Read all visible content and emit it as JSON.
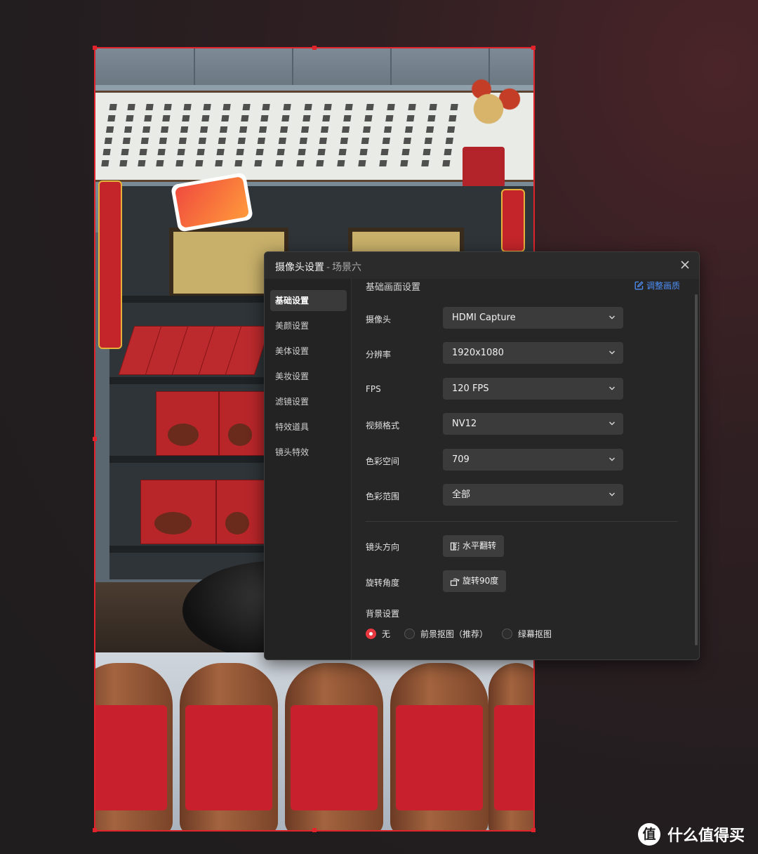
{
  "dialog": {
    "title": "摄像头设置",
    "title_separator": "-",
    "scene_name": "场景六",
    "close_icon": "close-icon"
  },
  "sidebar": {
    "items": [
      {
        "label": "基础设置",
        "active": true
      },
      {
        "label": "美颜设置",
        "active": false
      },
      {
        "label": "美体设置",
        "active": false
      },
      {
        "label": "美妆设置",
        "active": false
      },
      {
        "label": "滤镜设置",
        "active": false
      },
      {
        "label": "特效道具",
        "active": false
      },
      {
        "label": "镜头特效",
        "active": false
      }
    ]
  },
  "main": {
    "section_title": "基础画面设置",
    "adjust_link": "调整画质",
    "fields": [
      {
        "label": "摄像头",
        "value": "HDMI Capture"
      },
      {
        "label": "分辨率",
        "value": "1920x1080"
      },
      {
        "label": "FPS",
        "value": "120 FPS"
      },
      {
        "label": "视频格式",
        "value": "NV12"
      },
      {
        "label": "色彩空间",
        "value": "709"
      },
      {
        "label": "色彩范围",
        "value": "全部"
      }
    ],
    "lens_direction": {
      "label": "镜头方向",
      "button": "水平翻转"
    },
    "rotation": {
      "label": "旋转角度",
      "button": "旋转90度"
    },
    "background": {
      "label": "背景设置",
      "options": [
        {
          "label": "无",
          "checked": true
        },
        {
          "label": "前景抠图（推荐）",
          "checked": false
        },
        {
          "label": "绿幕抠图",
          "checked": false
        }
      ]
    }
  },
  "watermark": {
    "logo_char": "值",
    "text": "什么值得买"
  },
  "colors": {
    "accent_red": "#e8383f",
    "selection_border": "#e1242b",
    "link_blue": "#4f8ff7",
    "dialog_bg": "#262626"
  }
}
